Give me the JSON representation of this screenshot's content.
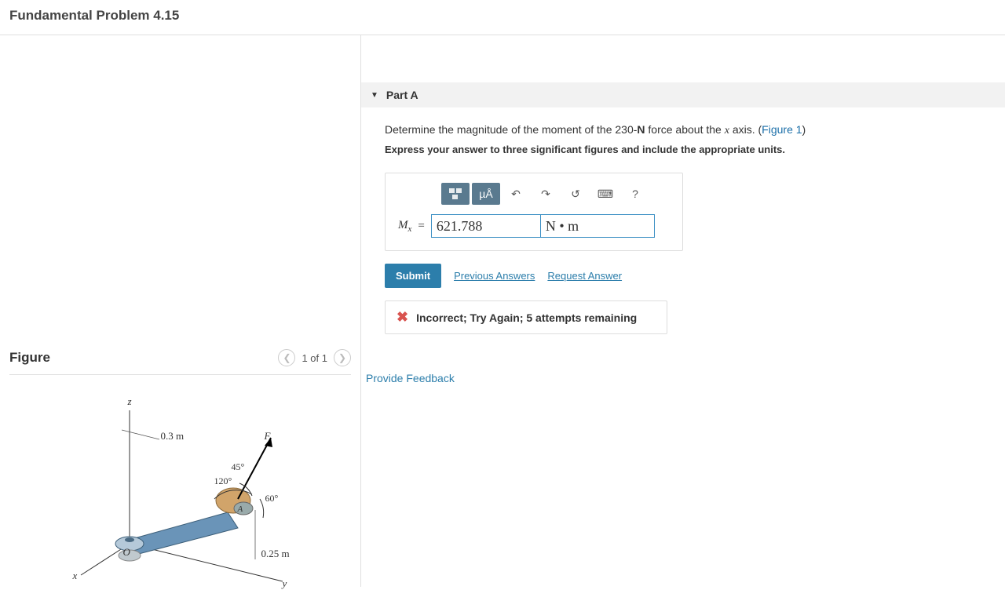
{
  "header": {
    "title": "Fundamental Problem 4.15"
  },
  "figure": {
    "title": "Figure",
    "nav_text": "1 of 1",
    "labels": {
      "z": "z",
      "x": "x",
      "y": "y",
      "O": "O",
      "F": "F",
      "A": "A",
      "dim_top": "0.3 m",
      "dim_bottom": "0.25 m",
      "angle45": "45°",
      "angle60": "60°",
      "angle120": "120°"
    }
  },
  "part": {
    "label": "Part A",
    "prompt_prefix": "Determine the magnitude of the moment of the 230-",
    "prompt_force_unit": "N",
    "prompt_mid": " force about the ",
    "prompt_axis": "x",
    "prompt_suffix": " axis. (",
    "figure_link": "Figure 1",
    "prompt_close": ")",
    "instructions": "Express your answer to three significant figures and include the appropriate units.",
    "toolbar": {
      "units_label": "µÅ",
      "help_label": "?"
    },
    "answer": {
      "var": "M",
      "subscript": "x",
      "equals": "=",
      "value": "621.788",
      "units": "N • m"
    },
    "actions": {
      "submit": "Submit",
      "previous": "Previous Answers",
      "request": "Request Answer"
    },
    "feedback": {
      "text": "Incorrect; Try Again; 5 attempts remaining"
    }
  },
  "links": {
    "provide_feedback": "Provide Feedback"
  }
}
